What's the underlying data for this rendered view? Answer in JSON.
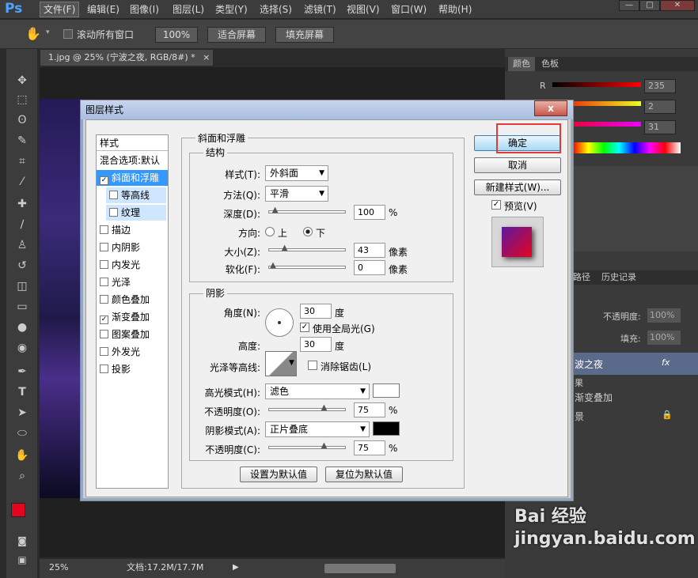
{
  "app_logo": "Ps",
  "menus": [
    "文件(F)",
    "编辑(E)",
    "图像(I)",
    "图层(L)",
    "类型(Y)",
    "选择(S)",
    "滤镜(T)",
    "视图(V)",
    "窗口(W)",
    "帮助(H)"
  ],
  "window_buttons": [
    "—",
    "□",
    "✕"
  ],
  "options": {
    "scroll_all_label": "滚动所有窗口",
    "zoom100": "100%",
    "fit_screen": "适合屏幕",
    "fill_screen": "填充屏幕"
  },
  "document_tab": {
    "title": "1.jpg @ 25% (宁波之夜, RGB/8#) *",
    "close": "×"
  },
  "status": {
    "zoom": "25%",
    "doc_info": "文档:17.2M/17.7M"
  },
  "right_panel": {
    "color_tab": "颜色",
    "swatches_tab": "色板",
    "r_label": "R",
    "r_value": "235",
    "g_value": "2",
    "b_value": "31",
    "layers_tabs": [
      "路径",
      "历史记录"
    ],
    "opacity_label": "不透明度:",
    "opacity_value": "100%",
    "fill_label": "填充:",
    "fill_value": "100%",
    "layer_name": "波之夜",
    "layer_fx": "fx",
    "effect_label": "果",
    "effect_item": "渐变叠加",
    "bg_label": "景"
  },
  "dialog": {
    "title": "图层样式",
    "close": "x",
    "styles_header": "样式",
    "blend_options": "混合选项:默认",
    "style_items": [
      {
        "label": "斜面和浮雕",
        "checked": "✓"
      },
      {
        "label": "等高线",
        "checked": ""
      },
      {
        "label": "纹理",
        "checked": ""
      },
      {
        "label": "描边",
        "checked": ""
      },
      {
        "label": "内阴影",
        "checked": ""
      },
      {
        "label": "内发光",
        "checked": ""
      },
      {
        "label": "光泽",
        "checked": ""
      },
      {
        "label": "颜色叠加",
        "checked": ""
      },
      {
        "label": "渐变叠加",
        "checked": "✓"
      },
      {
        "label": "图案叠加",
        "checked": ""
      },
      {
        "label": "外发光",
        "checked": ""
      },
      {
        "label": "投影",
        "checked": ""
      }
    ],
    "bevel_title": "斜面和浮雕",
    "structure_title": "结构",
    "style_label": "样式(T):",
    "style_value": "外斜面",
    "technique_label": "方法(Q):",
    "technique_value": "平滑",
    "depth_label": "深度(D):",
    "depth_value": "100",
    "depth_unit": "%",
    "direction_label": "方向:",
    "dir_up": "上",
    "dir_down": "下",
    "size_label": "大小(Z):",
    "size_value": "43",
    "size_unit": "像素",
    "soften_label": "软化(F):",
    "soften_value": "0",
    "soften_unit": "像素",
    "shading_title": "阴影",
    "angle_label": "角度(N):",
    "angle_value": "30",
    "angle_unit": "度",
    "global_light": "使用全局光(G)",
    "altitude_label": "高度:",
    "altitude_value": "30",
    "altitude_unit": "度",
    "gloss_label": "光泽等高线:",
    "antialias": "消除锯齿(L)",
    "highlight_label": "高光模式(H):",
    "highlight_value": "滤色",
    "hl_opacity_label": "不透明度(O):",
    "hl_opacity_value": "75",
    "hl_opacity_unit": "%",
    "shadow_label": "阴影模式(A):",
    "shadow_value": "正片叠底",
    "sh_opacity_label": "不透明度(C):",
    "sh_opacity_value": "75",
    "sh_opacity_unit": "%",
    "set_default": "设置为默认值",
    "reset_default": "复位为默认值",
    "ok": "确定",
    "cancel": "取消",
    "new_style": "新建样式(W)...",
    "preview": "预览(V)"
  },
  "sliders": {
    "depth": 0.03,
    "size": 0.17,
    "soften": 0.0,
    "hl_opacity": 0.75,
    "sh_opacity": 0.75
  },
  "colors": {
    "foreground": "#e8031f",
    "background": "#5a0d9e",
    "highlight_swatch": "#ffffff",
    "shadow_swatch": "#000000",
    "ok_highlight": "#e53935",
    "selection": "#3399ff"
  },
  "watermark": "Bai 经验 jingyan.baidu.com"
}
